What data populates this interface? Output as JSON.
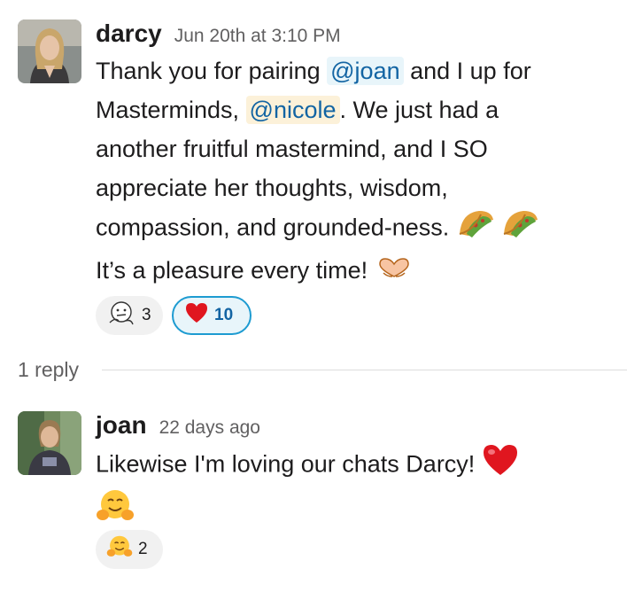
{
  "message": {
    "author": "darcy",
    "timestamp": "Jun 20th at 3:10 PM",
    "lines": {
      "l1_pre": "Thank you for pairing ",
      "mention_joan": "@joan",
      "l1_post": " and I up for",
      "l2_pre": "Masterminds, ",
      "mention_nicole": "@nicole",
      "l2_post": ". We just had a",
      "l3": "another fruitful mastermind, and I SO",
      "l4": "appreciate her thoughts, wisdom,",
      "l5": "compassion, and grounded-ness. ",
      "l6": "It’s a pleasure every time! "
    },
    "inline_emoji": [
      "taco-emoji",
      "taco-emoji",
      "heart-hands-emoji"
    ],
    "reactions": [
      {
        "emoji": "thinking-face-sketch",
        "count": "3",
        "selected": false
      },
      {
        "emoji": "red-heart",
        "count": "10",
        "selected": true
      }
    ]
  },
  "replies": {
    "label": "1 reply"
  },
  "reply": {
    "author": "joan",
    "timestamp": "22 days ago",
    "text": "Likewise I'm loving our chats Darcy! ",
    "inline_emoji": [
      "red-heart",
      "hugging-face"
    ],
    "reactions": [
      {
        "emoji": "hugging-face",
        "count": "2",
        "selected": false
      }
    ]
  },
  "colors": {
    "mention_bg": "#e8f5fa",
    "mention_self_bg": "#fcf1d9",
    "mention_text": "#1264a3",
    "selected_reaction_border": "#1d9bd1"
  }
}
